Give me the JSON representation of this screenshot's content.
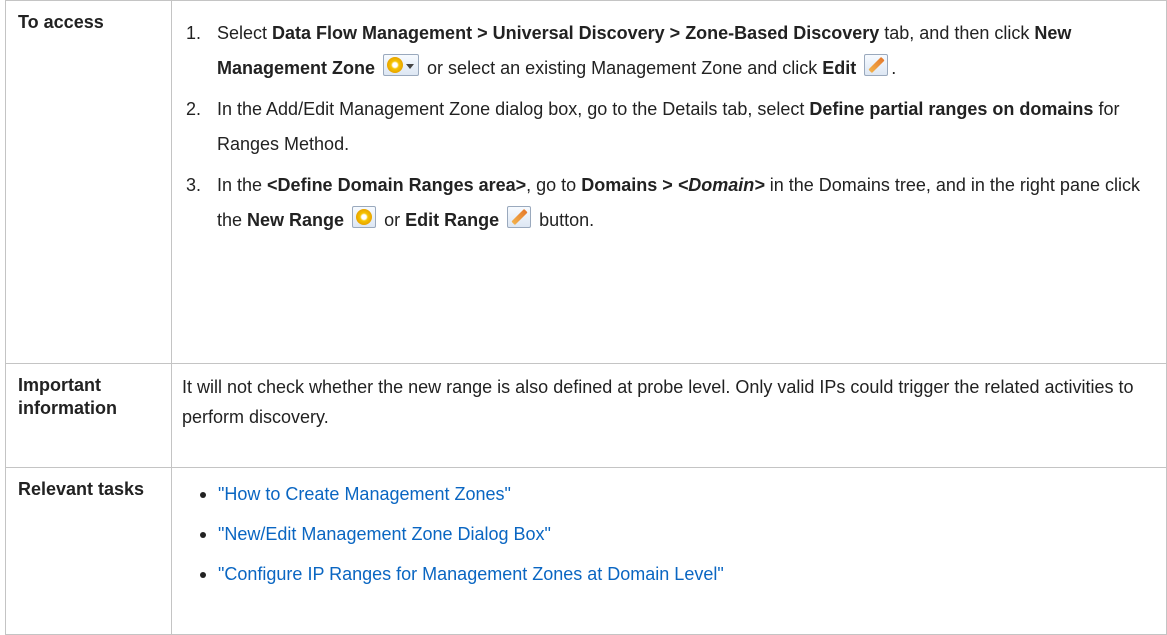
{
  "rows": {
    "access": {
      "header": "To access",
      "steps": [
        {
          "t1": "Select ",
          "b1": "Data Flow Management > Universal Discovery > Zone-Based Discovery",
          "t2": " tab, and then click ",
          "b2": "New Management Zone",
          "t3": " or select an existing Management Zone and click ",
          "b3": "Edit",
          "t4": "."
        },
        {
          "t1": "In the Add/Edit Management Zone dialog box, go to the Details tab, select ",
          "b1": "Define partial ranges on domains",
          "t2": " for Ranges Method."
        },
        {
          "t1": "In the ",
          "b1": "<Define Domain Ranges area>",
          "t2": ", go to ",
          "b2": "Domains > ",
          "b2i": "<Domain>",
          "t3": " in the Domains tree, and in the right pane click the ",
          "b3": "New Range",
          "t4": " or ",
          "b4": "Edit Range",
          "t5": " button."
        }
      ]
    },
    "info": {
      "header": "Important information",
      "text": "It will not check whether the new range is also defined at probe level. Only valid IPs could trigger the related activities to perform discovery."
    },
    "tasks": {
      "header": "Relevant tasks",
      "links": [
        "\"How to Create Management Zones\"",
        "\"New/Edit Management Zone Dialog Box\"",
        "\"Configure IP Ranges for Management Zones at Domain Level\""
      ]
    }
  },
  "icons": {
    "new_zone": "new-management-zone-icon",
    "edit": "edit-pencil-icon",
    "new_range": "new-range-icon",
    "edit_range": "edit-range-icon"
  },
  "colors": {
    "link": "#0a66c2",
    "border": "#c4c4c4"
  }
}
